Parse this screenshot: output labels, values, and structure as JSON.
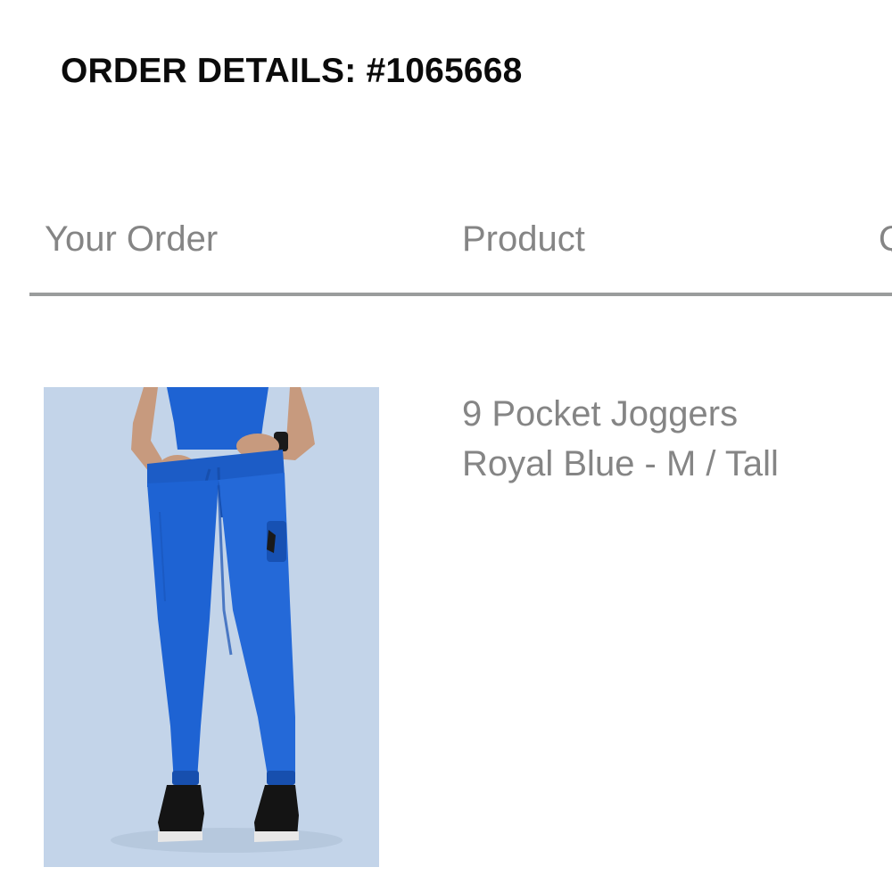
{
  "order": {
    "title": "ORDER DETAILS: #1065668"
  },
  "table": {
    "headers": {
      "your_order": "Your Order",
      "product": "Product",
      "next_cut": "Q"
    }
  },
  "item": {
    "name": "9 Pocket Joggers",
    "variant": "Royal Blue - M / Tall",
    "image_icon": "product-photo-joggers"
  },
  "colors": {
    "image_background": "#c3d4e9",
    "garment": "#1e63d3",
    "header_text": "#858585",
    "rule": "#9a9c9c"
  }
}
